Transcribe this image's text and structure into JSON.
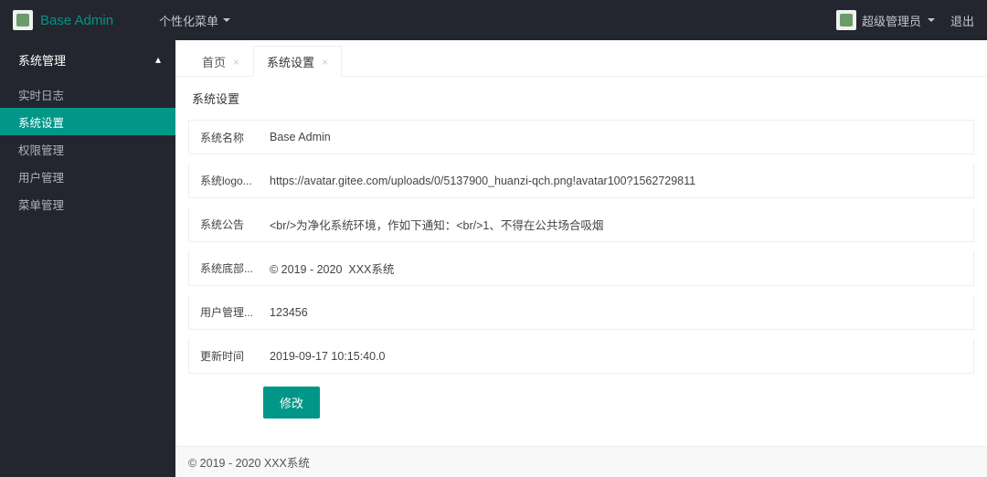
{
  "colors": {
    "accent": "#009688",
    "topbar_bg": "#23262e"
  },
  "topbar": {
    "brand": "Base Admin",
    "custom_menu": "个性化菜单",
    "user_name": "超级管理员",
    "logout": "退出"
  },
  "sidebar": {
    "group_label": "系统管理",
    "items": [
      {
        "label": "实时日志",
        "active": false
      },
      {
        "label": "系统设置",
        "active": true
      },
      {
        "label": "权限管理",
        "active": false
      },
      {
        "label": "用户管理",
        "active": false
      },
      {
        "label": "菜单管理",
        "active": false
      }
    ]
  },
  "tabs": {
    "items": [
      {
        "label": "首页",
        "active": false
      },
      {
        "label": "系统设置",
        "active": true
      }
    ]
  },
  "panel": {
    "title": "系统设置",
    "rows": [
      {
        "label": "系统名称",
        "value": "Base Admin"
      },
      {
        "label": "系统logo...",
        "value": "https://avatar.gitee.com/uploads/0/5137900_huanzi-qch.png!avatar100?1562729811"
      },
      {
        "label": "系统公告",
        "value": "<br/>为净化系统环境，作如下通知：<br/>1、不得在公共场合吸烟"
      },
      {
        "label": "系统底部...",
        "value": "© 2019 - 2020  XXX系统"
      },
      {
        "label": "用户管理...",
        "value": "123456"
      },
      {
        "label": "更新时间",
        "value": "2019-09-17 10:15:40.0"
      }
    ],
    "submit_label": "修改"
  },
  "footer": "© 2019 - 2020 XXX系统"
}
